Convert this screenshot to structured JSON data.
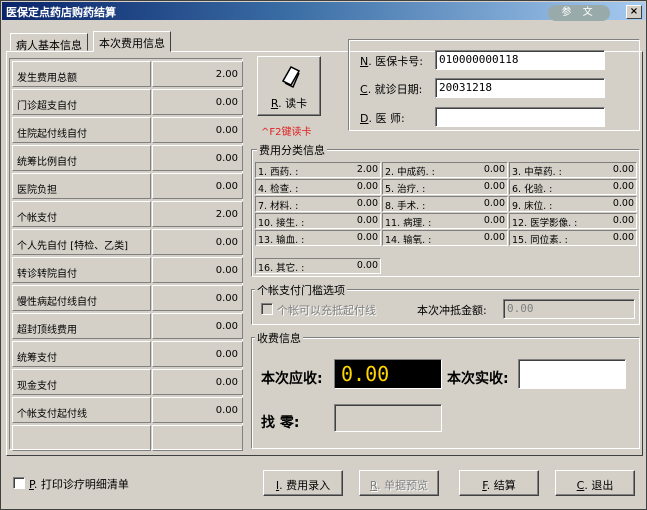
{
  "window": {
    "title": "医保定点药店购药结算",
    "logo_text": "参 文",
    "close_label": "×"
  },
  "tabs": [
    {
      "label": "病人基本信息"
    },
    {
      "label": "本次费用信息"
    }
  ],
  "cost_table": [
    {
      "label": "发生费用总额",
      "value": "2.00"
    },
    {
      "label": "门诊超支自付",
      "value": "0.00"
    },
    {
      "label": "住院起付线自付",
      "value": "0.00"
    },
    {
      "label": "统筹比例自付",
      "value": "0.00"
    },
    {
      "label": "医院负担",
      "value": "0.00"
    },
    {
      "label": "个帐支付",
      "value": "2.00"
    },
    {
      "label": "个人先自付 [特检、乙类]",
      "value": "0.00"
    },
    {
      "label": "转诊转院自付",
      "value": "0.00"
    },
    {
      "label": "慢性病起付线自付",
      "value": "0.00"
    },
    {
      "label": "超封顶线费用",
      "value": "0.00"
    },
    {
      "label": "统筹支付",
      "value": "0.00"
    },
    {
      "label": "现金支付",
      "value": "0.00"
    },
    {
      "label": "个帐支付起付线",
      "value": "0.00"
    },
    {
      "label": "",
      "value": ""
    }
  ],
  "read_card": {
    "key": "R",
    "label": ". 读卡",
    "hint": "^F2键读卡"
  },
  "patient": {
    "card_no_key": "N",
    "card_no_label": ". 医保卡号:",
    "card_no_value": "010000000118",
    "date_key": "C",
    "date_label": ". 就诊日期:",
    "date_value": "20031218",
    "doctor_key": "D",
    "doctor_label": ". 医    师:",
    "doctor_value": ""
  },
  "fee_groups": {
    "title": "费用分类信息",
    "items": [
      {
        "label": "1. 西药. :",
        "value": "2.00"
      },
      {
        "label": "2. 中成药. :",
        "value": "0.00"
      },
      {
        "label": "3. 中草药. :",
        "value": "0.00"
      },
      {
        "label": "4. 检查. :",
        "value": "0.00"
      },
      {
        "label": "5. 治疗. :",
        "value": "0.00"
      },
      {
        "label": "6. 化验. :",
        "value": "0.00"
      },
      {
        "label": "7. 材料. :",
        "value": "0.00"
      },
      {
        "label": "8. 手术. :",
        "value": "0.00"
      },
      {
        "label": "9. 床位. :",
        "value": "0.00"
      },
      {
        "label": "10. 接生. :",
        "value": "0.00"
      },
      {
        "label": "11. 病理. :",
        "value": "0.00"
      },
      {
        "label": "12. 医学影像. :",
        "value": "0.00"
      },
      {
        "label": "13. 输血. :",
        "value": "0.00"
      },
      {
        "label": "14. 输氧. :",
        "value": "0.00"
      },
      {
        "label": "15. 同位素. :",
        "value": "0.00"
      },
      {
        "label": "16. 其它. :",
        "value": "0.00"
      }
    ]
  },
  "threshold": {
    "title": "个帐支付门槛选项",
    "checkbox_label": "个帐可以充抵起付线",
    "amount_label": "本次冲抵金额:",
    "amount_value": "0.00"
  },
  "charge": {
    "title": "收费信息",
    "due_label": "本次应收:",
    "due_value": "0.00",
    "paid_label": "本次实收:",
    "paid_value": "",
    "change_label": "找    零:",
    "change_value": ""
  },
  "footer": {
    "print_key": "P",
    "print_label": ". 打印诊疗明细清单",
    "buttons": [
      {
        "key": "I",
        "label": ". 费用录入"
      },
      {
        "key": "R",
        "label": ". 单据预览"
      },
      {
        "key": "F",
        "label": ". 结算"
      },
      {
        "key": "C",
        "label": ". 退出"
      }
    ]
  }
}
